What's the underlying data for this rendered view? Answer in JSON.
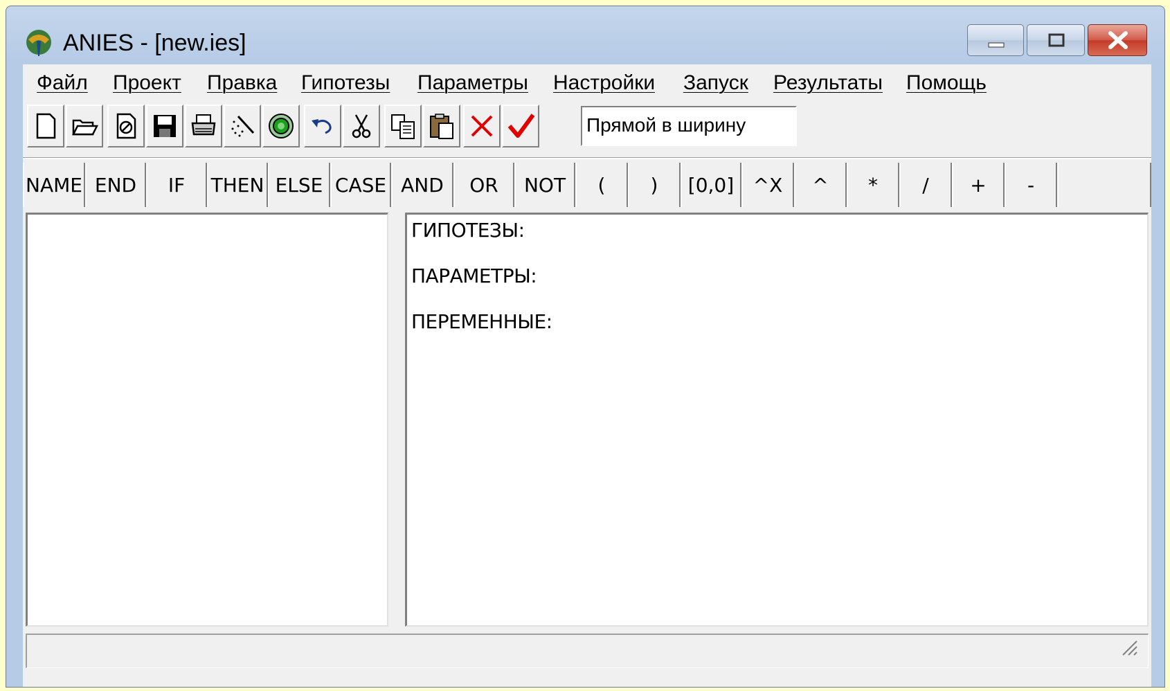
{
  "window": {
    "title": "ANIES - [new.ies]"
  },
  "menu": [
    {
      "label": "Файл"
    },
    {
      "label": "Проект"
    },
    {
      "label": "Правка"
    },
    {
      "label": "Гипотезы"
    },
    {
      "label": "Параметры"
    },
    {
      "label": "Настройки"
    },
    {
      "label": "Запуск"
    },
    {
      "label": "Результаты"
    },
    {
      "label": "Помощь"
    }
  ],
  "toolbar": {
    "icons": [
      "new-document-icon",
      "open-folder-icon",
      "close-document-icon",
      "save-icon",
      "print-icon",
      "magic-wand-icon",
      "target-icon",
      "undo-icon",
      "cut-icon",
      "copy-icon",
      "paste-icon",
      "delete-icon",
      "check-icon"
    ],
    "mode_combo_value": "Прямой в ширину"
  },
  "keywords": [
    {
      "label": "NAME"
    },
    {
      "label": "END"
    },
    {
      "label": "IF"
    },
    {
      "label": "THEN"
    },
    {
      "label": "ELSE"
    },
    {
      "label": "CASE"
    },
    {
      "label": "AND"
    },
    {
      "label": "OR"
    },
    {
      "label": "NOT"
    },
    {
      "label": "("
    },
    {
      "label": ")"
    },
    {
      "label": "[0,0]"
    },
    {
      "label": "^X"
    },
    {
      "label": "^"
    },
    {
      "label": "*"
    },
    {
      "label": "/"
    },
    {
      "label": "+"
    },
    {
      "label": "-"
    }
  ],
  "editor": {
    "lines": [
      "ГИПОТЕЗЫ:",
      "ПАРАМЕТРЫ:",
      "ПЕРЕМЕННЫЕ:"
    ]
  },
  "colors": {
    "titlebar": "#b6cbe6",
    "close_button": "#c43a28",
    "check": "#e00000",
    "delete": "#e00000",
    "target": "#1aa01a"
  }
}
